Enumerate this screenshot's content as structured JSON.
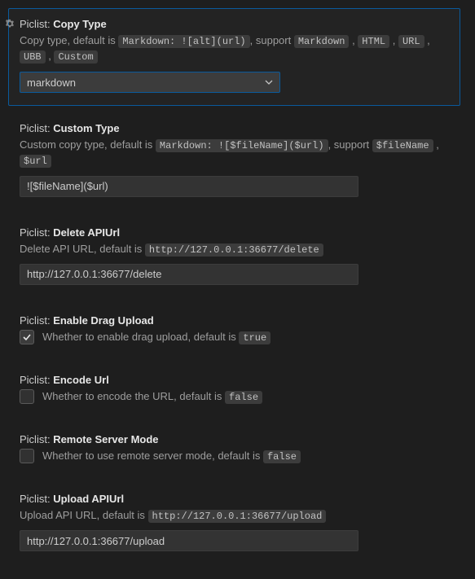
{
  "prefix": "Piclist:",
  "copyType": {
    "name": "Copy Type",
    "desc1": "Copy type, default is ",
    "defCode": "Markdown: ![alt](url)",
    "desc2": ", support ",
    "supports": [
      "Markdown",
      "HTML",
      "URL",
      "UBB",
      "Custom"
    ],
    "value": "markdown"
  },
  "customType": {
    "name": "Custom Type",
    "desc1": "Custom copy type, default is ",
    "defCode": "Markdown: ![$fileName]($url)",
    "desc2": ", support ",
    "supports": [
      "$fileName",
      "$url"
    ],
    "value": "![$fileName]($url)"
  },
  "deleteApi": {
    "name": "Delete APIUrl",
    "desc1": "Delete API URL, default is ",
    "defCode": "http://127.0.0.1:36677/delete",
    "value": "http://127.0.0.1:36677/delete"
  },
  "enableDrag": {
    "name": "Enable Drag Upload",
    "label1": "Whether to enable drag upload, default is ",
    "defCode": "true",
    "checked": true
  },
  "encodeUrl": {
    "name": "Encode Url",
    "label1": "Whether to encode the URL, default is ",
    "defCode": "false",
    "checked": false
  },
  "remoteMode": {
    "name": "Remote Server Mode",
    "label1": "Whether to use remote server mode, default is ",
    "defCode": "false",
    "checked": false
  },
  "uploadApi": {
    "name": "Upload APIUrl",
    "desc1": "Upload API URL, default is ",
    "defCode": "http://127.0.0.1:36677/upload",
    "value": "http://127.0.0.1:36677/upload"
  }
}
